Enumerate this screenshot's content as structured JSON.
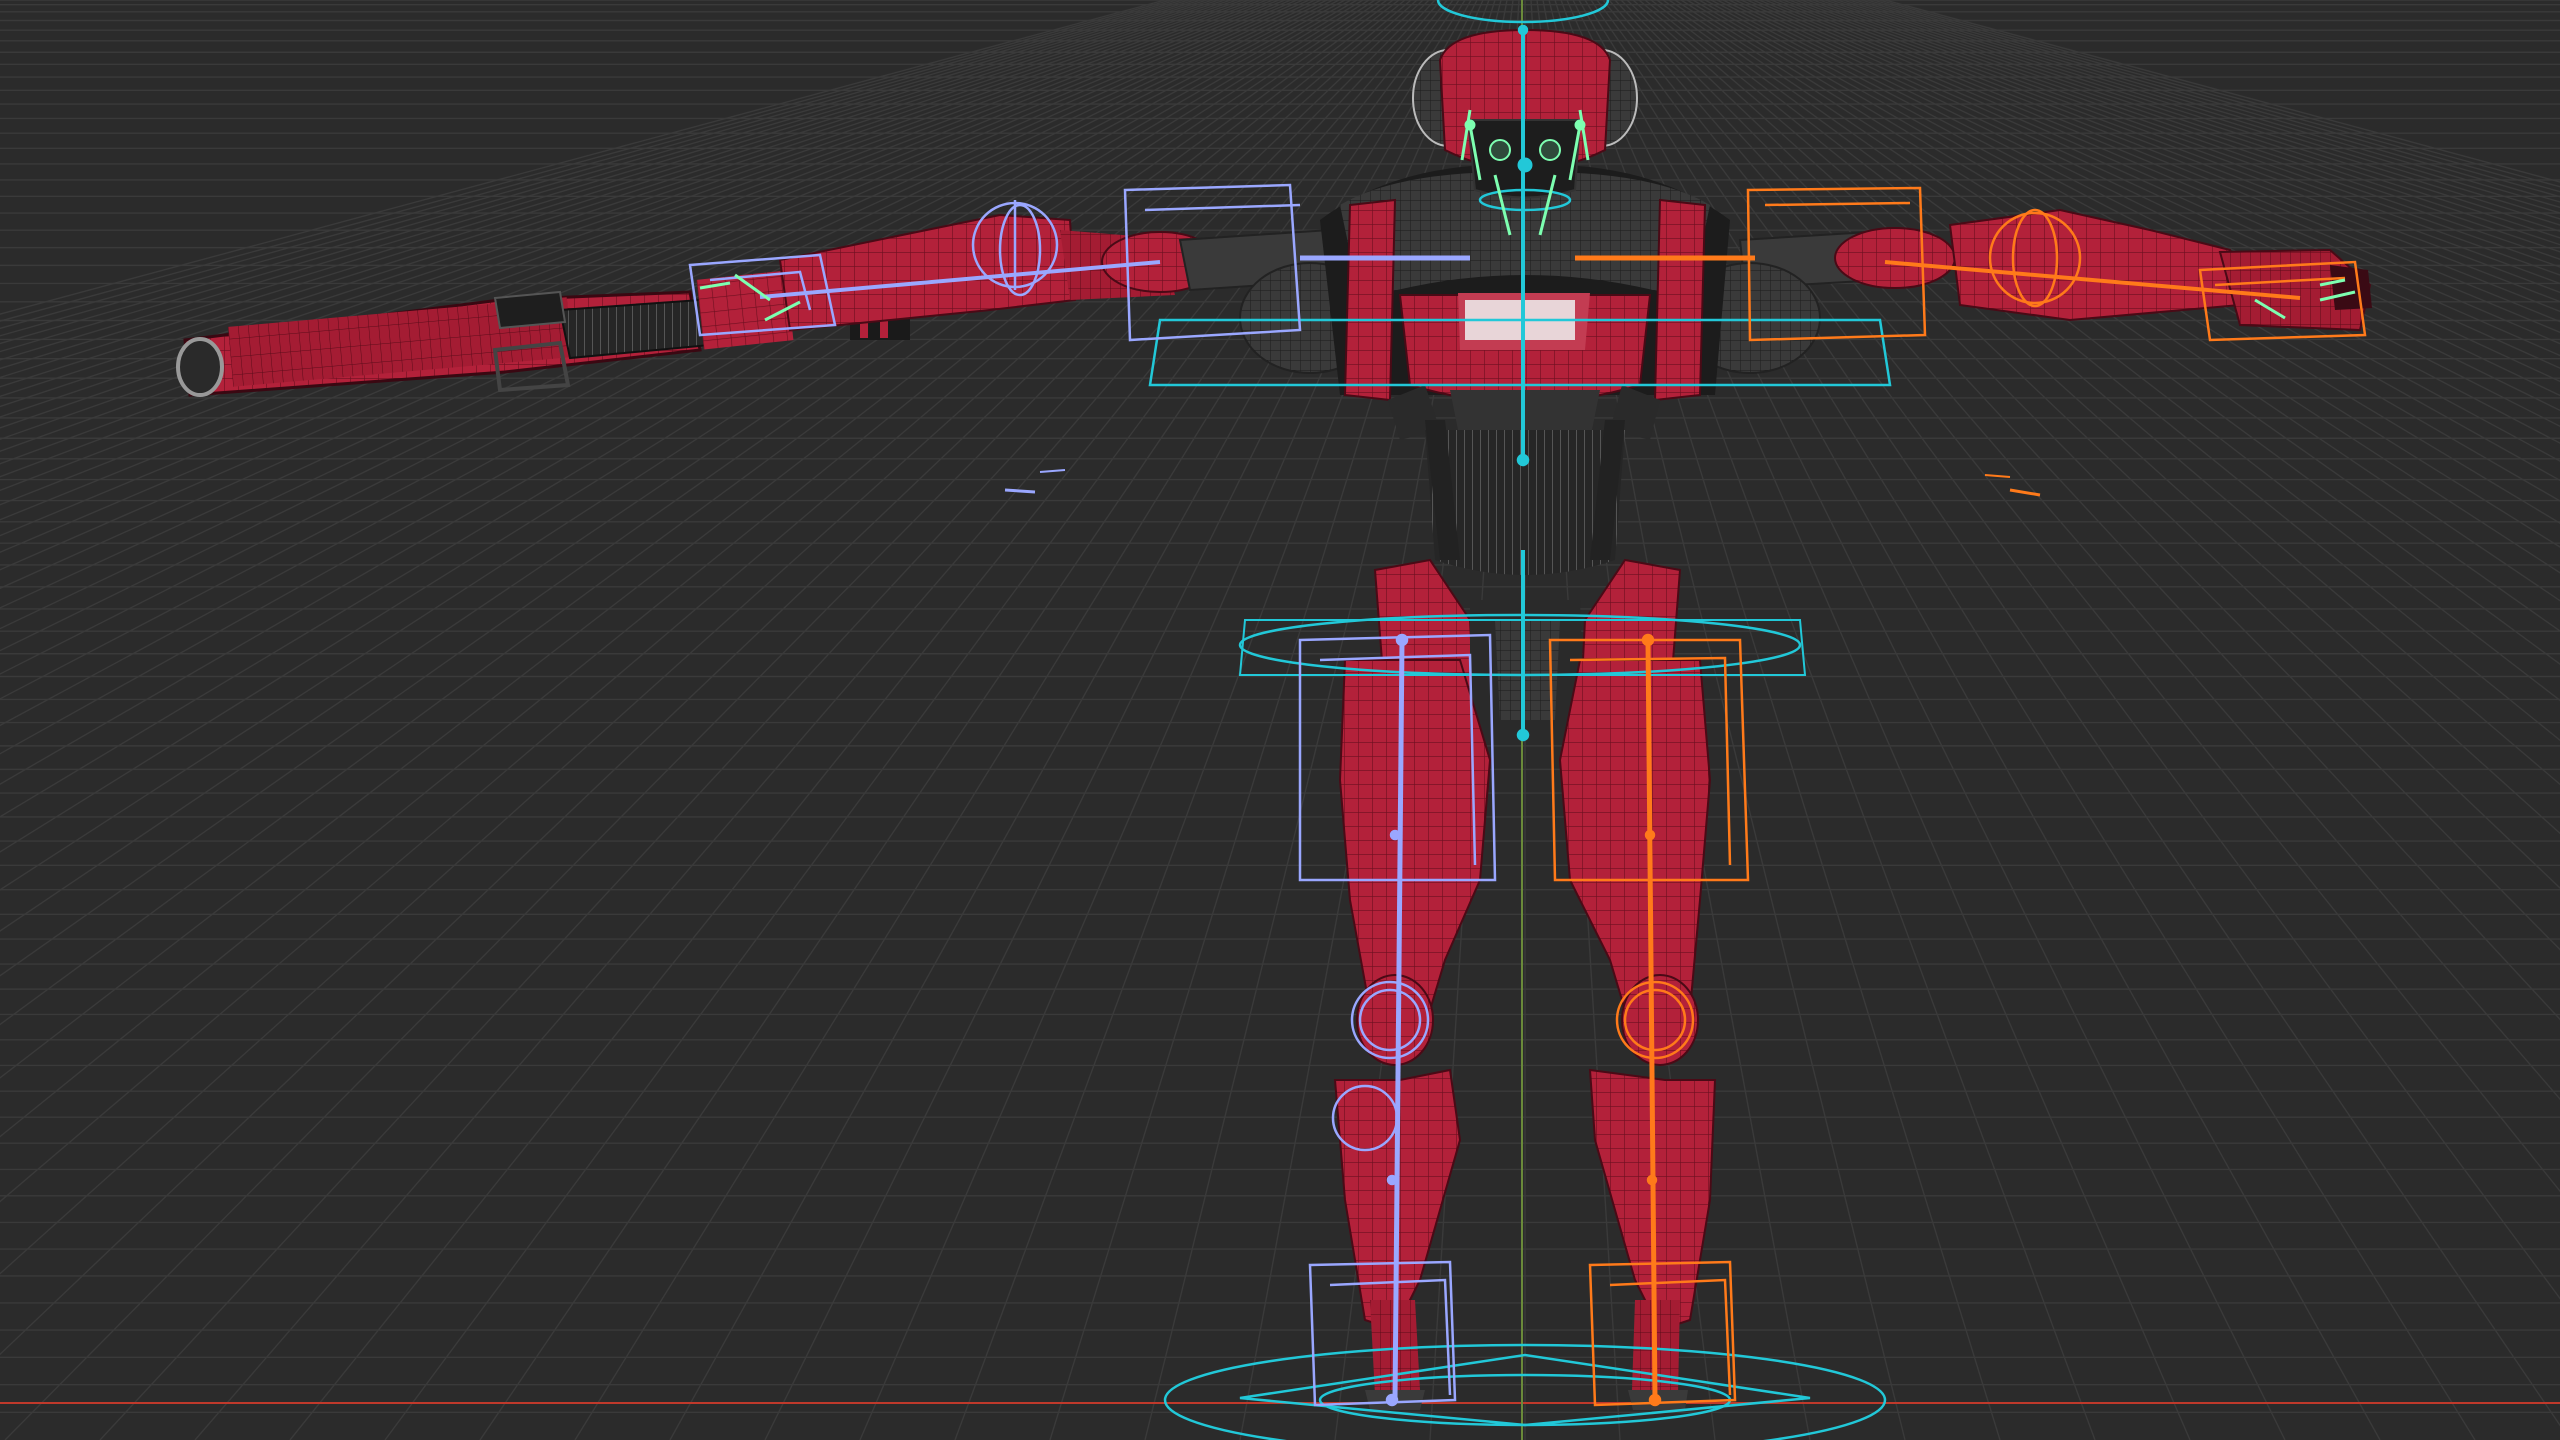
{
  "viewport": {
    "background": "#2b2b2b",
    "grid_color": "#3a3a3a",
    "x_axis_color": "#c0392b",
    "z_axis_color": "#6a8a3a"
  },
  "scene": {
    "model": "robot-character",
    "mesh_color": "#b3213a",
    "mesh_dark": "#6d0f1f",
    "shell_color": "#3c3c3c",
    "rig_colors": {
      "center": "#22c8d8",
      "left": "#9aa7ff",
      "right": "#ff7a1a",
      "ik": "#7dffb0"
    }
  }
}
